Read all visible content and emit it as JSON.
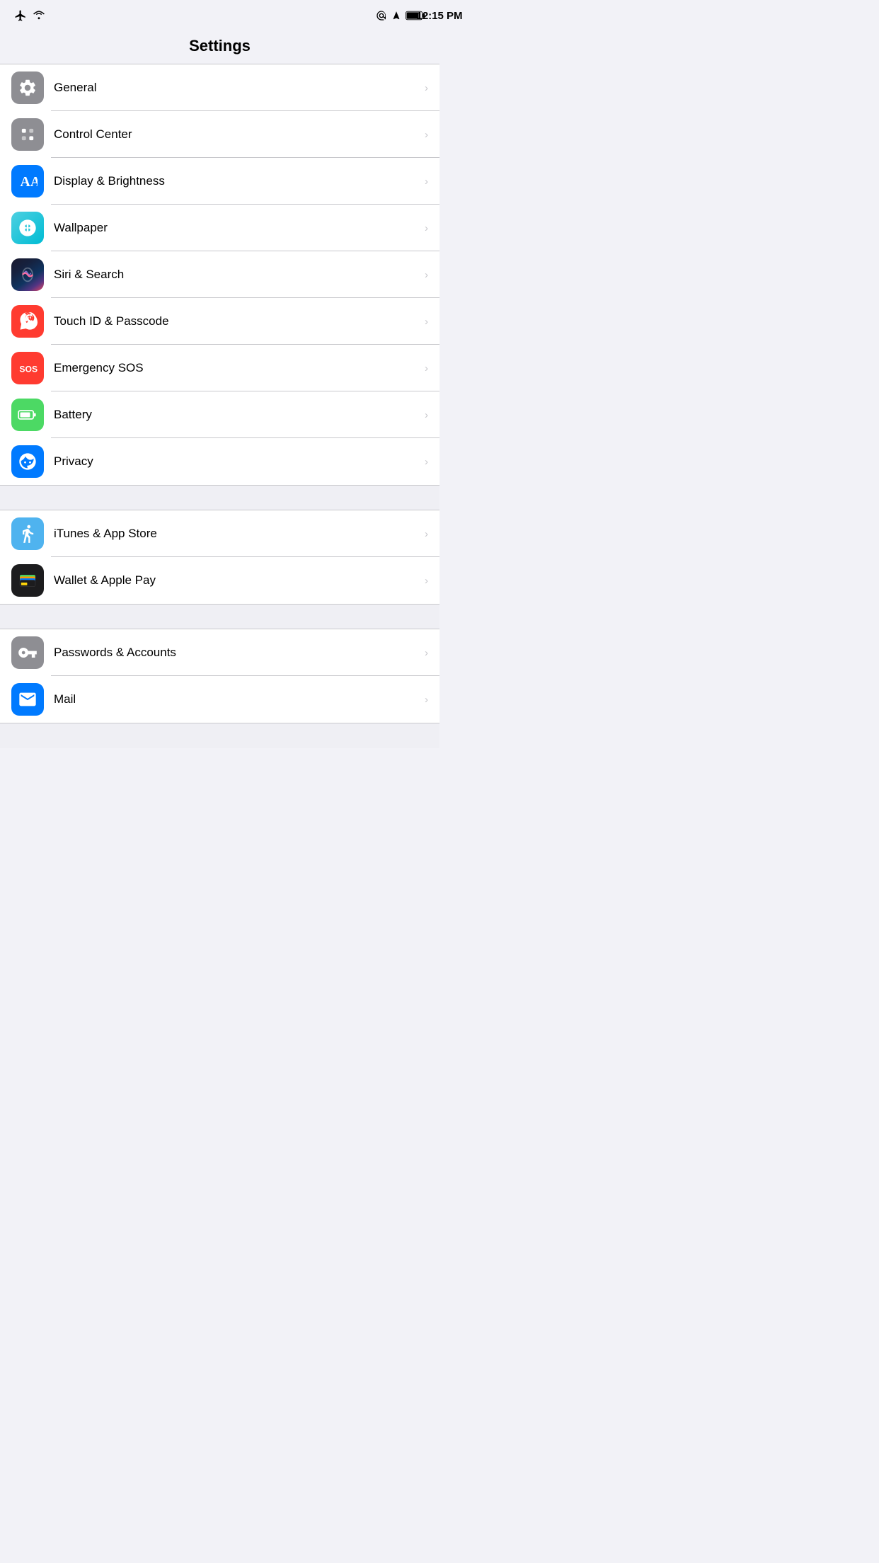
{
  "statusBar": {
    "time": "12:15 PM",
    "leftIcons": [
      "airplane-icon",
      "wifi-icon"
    ],
    "rightIcons": [
      "at-icon",
      "location-icon",
      "battery-icon"
    ]
  },
  "header": {
    "title": "Settings"
  },
  "sections": [
    {
      "id": "section-system",
      "items": [
        {
          "id": "general",
          "label": "General",
          "icon": "gear",
          "iconBg": "gray"
        },
        {
          "id": "control-center",
          "label": "Control Center",
          "icon": "toggle",
          "iconBg": "gray"
        },
        {
          "id": "display-brightness",
          "label": "Display & Brightness",
          "icon": "font",
          "iconBg": "blue"
        },
        {
          "id": "wallpaper",
          "label": "Wallpaper",
          "icon": "flower",
          "iconBg": "teal"
        },
        {
          "id": "siri-search",
          "label": "Siri & Search",
          "icon": "siri",
          "iconBg": "siri"
        },
        {
          "id": "touch-id",
          "label": "Touch ID & Passcode",
          "icon": "fingerprint",
          "iconBg": "red"
        },
        {
          "id": "emergency-sos",
          "label": "Emergency SOS",
          "icon": "sos",
          "iconBg": "red"
        },
        {
          "id": "battery",
          "label": "Battery",
          "icon": "battery",
          "iconBg": "green"
        },
        {
          "id": "privacy",
          "label": "Privacy",
          "icon": "hand",
          "iconBg": "blue"
        }
      ]
    },
    {
      "id": "section-store",
      "items": [
        {
          "id": "itunes-appstore",
          "label": "iTunes & App Store",
          "icon": "appstore",
          "iconBg": "cyan"
        },
        {
          "id": "wallet-applepay",
          "label": "Wallet & Apple Pay",
          "icon": "wallet",
          "iconBg": "dark"
        }
      ]
    },
    {
      "id": "section-accounts",
      "items": [
        {
          "id": "passwords-accounts",
          "label": "Passwords & Accounts",
          "icon": "key",
          "iconBg": "gray"
        },
        {
          "id": "mail",
          "label": "Mail",
          "icon": "mail",
          "iconBg": "blue"
        }
      ]
    }
  ]
}
